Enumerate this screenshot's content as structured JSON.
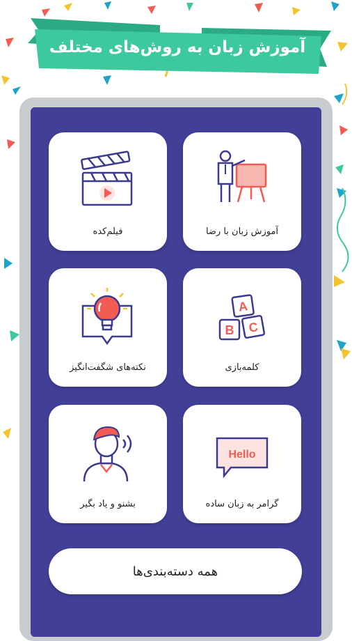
{
  "header": {
    "title": "آموزش زبان به روش‌های مختلف"
  },
  "cards": [
    {
      "label": "آموزش زبان با رضا",
      "icon": "teacher-presentation-icon"
    },
    {
      "label": "فیلم‌کده",
      "icon": "clapperboard-icon"
    },
    {
      "label": "کلمه‌بازی",
      "icon": "abc-blocks-icon"
    },
    {
      "label": "نکته‌های شگفت‌انگیز",
      "icon": "lightbulb-icon"
    },
    {
      "label": "گرامر به زبان ساده",
      "icon": "hello-speech-bubble-icon"
    },
    {
      "label": "بشنو و یاد بگیر",
      "icon": "listening-person-icon"
    }
  ],
  "hello_text": "Hello",
  "blocks": {
    "a": "A",
    "b": "B",
    "c": "C"
  },
  "all_categories_label": "همه دسته‌بندی‌ها",
  "colors": {
    "ribbon": "#3cc99e",
    "panel": "#423f96",
    "accent": "#f25c54",
    "outline": "#3b3a8c"
  }
}
